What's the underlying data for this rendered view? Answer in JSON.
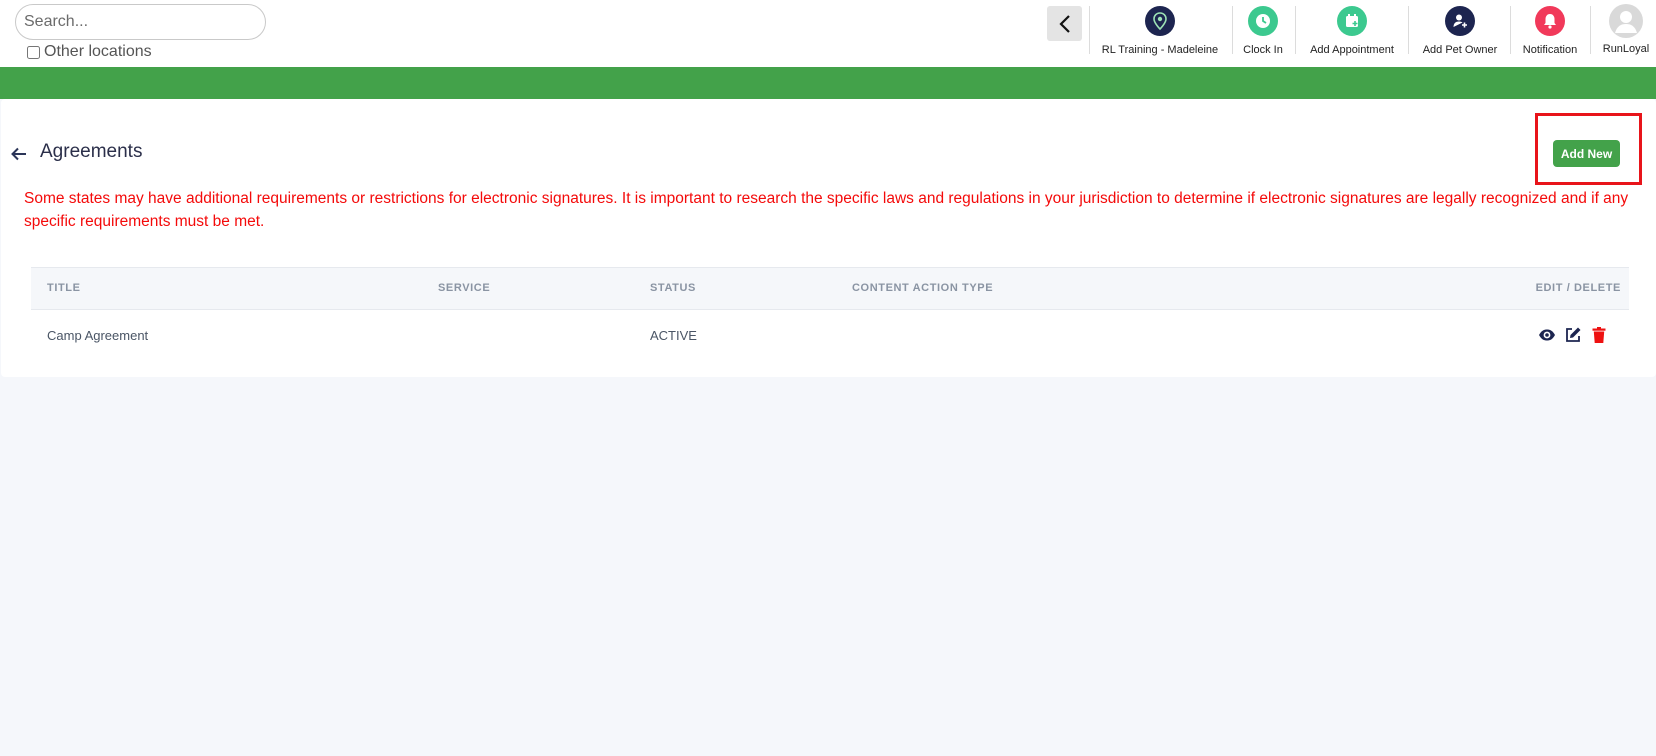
{
  "search": {
    "placeholder": "Search..."
  },
  "other_locations": {
    "label": "Other locations",
    "checked": false
  },
  "nav": {
    "location": {
      "label": "RL Training - Madeleine",
      "icon": "location-pin-icon",
      "color": "#1d2550"
    },
    "clock_in": {
      "label": "Clock In",
      "icon": "clock-icon",
      "color": "#3cc98f"
    },
    "add_appointment": {
      "label": "Add Appointment",
      "icon": "calendar-plus-icon",
      "color": "#3cc98f"
    },
    "add_pet_owner": {
      "label": "Add Pet Owner",
      "icon": "user-plus-icon",
      "color": "#1d2550"
    },
    "notification": {
      "label": "Notification",
      "icon": "bell-icon",
      "color": "#f1395a"
    },
    "profile": {
      "label": "RunLoyal",
      "icon": "avatar-icon",
      "color": "#d9d9d9"
    }
  },
  "page": {
    "title": "Agreements",
    "add_new_label": "Add New",
    "warning": "Some states may have additional requirements or restrictions for electronic signatures. It is important to research the specific laws and regulations in your jurisdiction to determine if electronic signatures are legally recognized and if any specific requirements must be met."
  },
  "table": {
    "columns": [
      "TITLE",
      "SERVICE",
      "STATUS",
      "CONTENT ACTION TYPE",
      "EDIT / DELETE"
    ],
    "rows": [
      {
        "title": "Camp Agreement",
        "service": "",
        "status": "ACTIVE",
        "content_action_type": ""
      }
    ]
  },
  "colors": {
    "brand_green": "#43a24a",
    "warning_red": "#f40a0a",
    "highlight_red": "#e8141a",
    "icon_dark": "#1d2550",
    "delete_red": "#ee1111"
  }
}
